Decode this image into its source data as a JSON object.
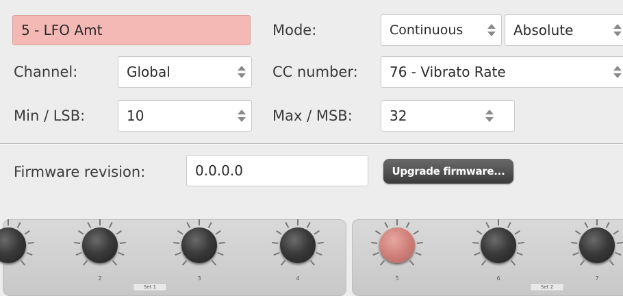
{
  "param_name": "5 - LFO Amt",
  "mode": {
    "label": "Mode:",
    "value": "Continuous",
    "value2": "Absolute"
  },
  "channel": {
    "label": "Channel:",
    "value": "Global"
  },
  "cc": {
    "label": "CC number:",
    "value": "76 - Vibrato Rate"
  },
  "min": {
    "label": "Min / LSB:",
    "value": "10"
  },
  "max": {
    "label": "Max / MSB:",
    "value": "32"
  },
  "firmware": {
    "label": "Firmware revision:",
    "value": "0.0.0.0",
    "button": "Upgrade firmware..."
  },
  "knobs": {
    "k2": "2",
    "k3": "3",
    "k4": "4",
    "k5": "5",
    "k6": "6",
    "k7": "7"
  },
  "sets": {
    "set1": "Set 1",
    "set2": "Set 2"
  },
  "colors": {
    "active": "#f5b9b5",
    "knob_active": "#d07f79",
    "button": "#4a4a4a"
  }
}
